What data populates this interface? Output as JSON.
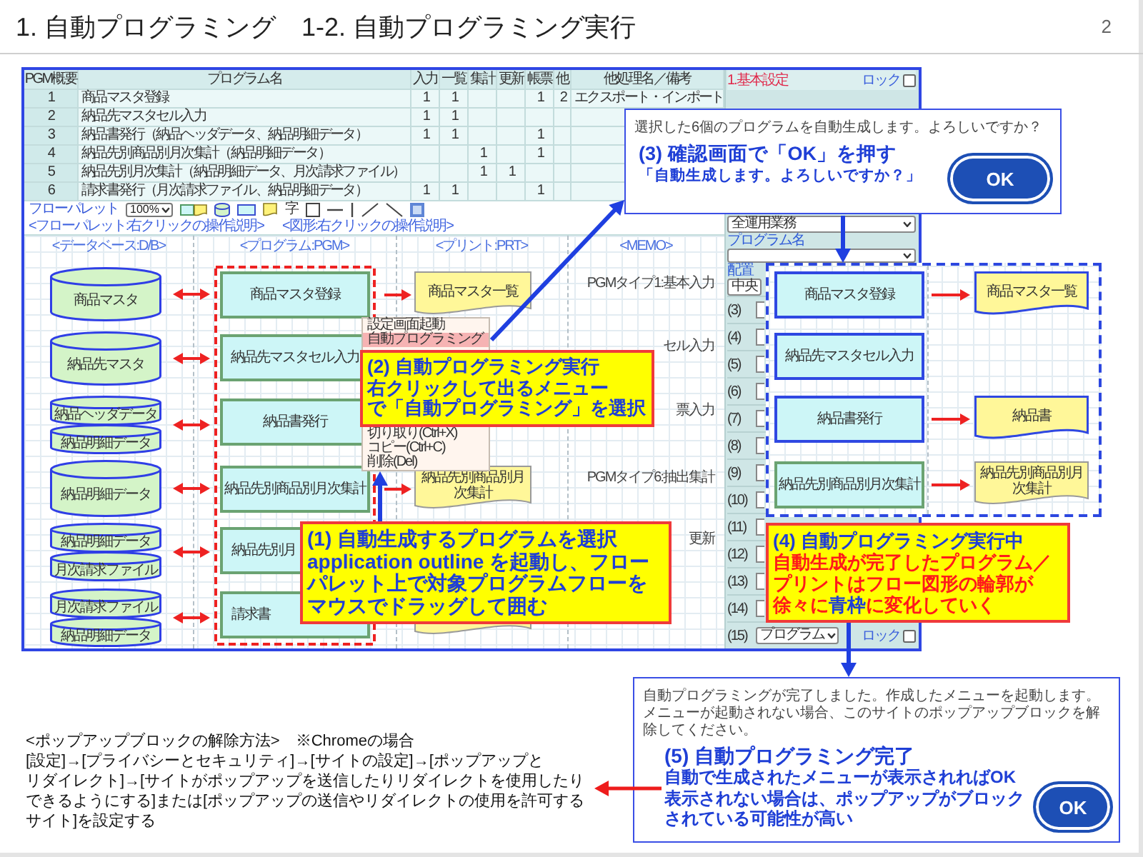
{
  "title": "1. 自動プログラミング　1-2. 自動プログラミング実行",
  "page_number": "2",
  "app": {
    "table": {
      "columns": [
        "PGM概要",
        "プログラム名",
        "入力",
        "一覧",
        "集計",
        "更新",
        "帳票",
        "他",
        "他処理名／備考"
      ],
      "rows": [
        [
          "1",
          "商品マスタ登録",
          "1",
          "1",
          null,
          null,
          "1",
          "2",
          "エクスポート・インポート"
        ],
        [
          "2",
          "納品先マスタセル入力",
          "1",
          "1",
          null,
          null,
          null,
          null,
          null
        ],
        [
          "3",
          "納品書発行（納品ヘッダデータ、納品明細データ）",
          "1",
          "1",
          null,
          null,
          "1",
          null,
          null
        ],
        [
          "4",
          "納品先別商品別月次集計（納品明細データ）",
          null,
          null,
          "1",
          null,
          "1",
          null,
          null
        ],
        [
          "5",
          "納品先別月次集計（納品明細データ、月次請求ファイル）",
          null,
          null,
          "1",
          "1",
          null,
          null,
          null
        ],
        [
          "6",
          "請求書発行（月次請求ファイル、納品明細データ）",
          "1",
          "1",
          null,
          null,
          "1",
          null,
          null
        ]
      ]
    },
    "toolbar": {
      "label": "フローパレット",
      "zoom": "100%",
      "tools": [
        {
          "kind": "process-document"
        },
        {
          "kind": "cylinder"
        },
        {
          "kind": "rectangle"
        },
        {
          "kind": "document"
        },
        {
          "kind": "text",
          "label": "字"
        },
        {
          "kind": "square"
        },
        {
          "kind": "horizontal-line"
        },
        {
          "kind": "vertical-line"
        },
        {
          "kind": "rising-line"
        },
        {
          "kind": "falling-line"
        },
        {
          "kind": "image"
        }
      ],
      "links": [
        "<フローパレット:右クリックの操作説明>",
        "<図形:右クリックの操作説明>"
      ]
    },
    "flow": {
      "lanes": [
        "<データベース:D/B>",
        "<プログラム:PGM>",
        "<プリント:PRT>",
        "<MEMO>"
      ],
      "rows": [
        {
          "databases": [
            "商品マスタ"
          ],
          "program": {
            "label": "商品マスタ登録",
            "clipped": false
          },
          "link": true,
          "print": {
            "kind": "document",
            "label": "商品マスタ一覧"
          },
          "memo": "PGMタイプ1:基本入力"
        },
        {
          "databases": [
            "納品先マスタ"
          ],
          "program": {
            "label": "納品先マスタセル入力",
            "clipped": false
          },
          "memo": "セル入力"
        },
        {
          "databases": [
            "納品ヘッダデータ",
            "納品明細データ"
          ],
          "program": {
            "label": "納品書発行",
            "clipped": false
          },
          "memo": "票入力"
        },
        {
          "databases": [
            "納品明細データ"
          ],
          "program": {
            "label": "納品先別商品別月次集計",
            "clipped": false
          },
          "link": true,
          "print": {
            "kind": "document",
            "label": "納品先別商品別月次集計"
          },
          "memo": "PGMタイプ6:抽出集計"
        },
        {
          "databases": [
            "納品明細データ",
            "月次請求ファイル"
          ],
          "program": {
            "label": "納品先別月",
            "clipped": true
          },
          "memo": "更新"
        },
        {
          "databases": [
            "月次請求ファイル",
            "納品明細データ"
          ],
          "program": {
            "label": "請求書",
            "clipped": true
          },
          "print": {
            "kind": "document-edge"
          }
        }
      ]
    },
    "panel": {
      "title": "1.基本設定",
      "lock_label": "ロック",
      "locked": false,
      "business": "全運用業務",
      "program_label": "プログラム名",
      "align_label": "配置",
      "align": "中央",
      "slots": [
        {
          "label": "(3)"
        },
        {
          "label": "(4)"
        },
        {
          "label": "(5)"
        },
        {
          "label": "(6)"
        },
        {
          "label": "(7)"
        },
        {
          "label": "(8)"
        },
        {
          "label": "(9)"
        },
        {
          "label": "(10)"
        },
        {
          "label": "(11)"
        },
        {
          "label": "(12)"
        },
        {
          "label": "(13)"
        },
        {
          "label": "(14)"
        },
        {
          "label": "(15)",
          "value": "プログラム",
          "lock_label": "ロック",
          "locked": false
        }
      ]
    }
  },
  "context_menu": {
    "items": [
      {
        "label": "設定画面起動",
        "selected": false
      },
      {
        "label": "自動プログラミング",
        "selected": true
      }
    ],
    "lower_items": [
      {
        "label": "切り取り(Ctrl+X)",
        "selected": false
      },
      {
        "label": "コピー(Ctrl+C)",
        "selected": false
      },
      {
        "label": "削除(Del)",
        "selected": false
      }
    ]
  },
  "preview": {
    "rows": [
      {
        "program": {
          "label": "商品マスタ登録",
          "done": true
        },
        "print": {
          "label": "商品マスタ一覧",
          "done": true
        }
      },
      {
        "program": {
          "label": "納品先マスタセル入力",
          "done": true
        }
      },
      {
        "program": {
          "label": "納品書発行",
          "done": true
        },
        "print": {
          "label": "納品書",
          "done": true
        }
      },
      {
        "program": {
          "label": "納品先別商品別月次集計",
          "done": false
        },
        "print": {
          "label": "納品先別商品別月次集計",
          "done": false
        }
      }
    ]
  },
  "steps": [
    {
      "kind": "dialog",
      "messages": [
        "選択した6個のプログラムを自動生成します。よろしいですか？"
      ],
      "note_heading": "(3) 確認画面で「OK」を押す",
      "note_lines": [
        "「自動生成します。よろしいですか？」"
      ],
      "button": "OK"
    },
    {
      "kind": "callout",
      "lines": [
        [
          {
            "text": "(2) 自動プログラミング実行",
            "color": "#1f3fd6"
          }
        ],
        [
          {
            "text": "右クリックして出るメニュー",
            "color": "#1f3fd6"
          }
        ],
        [
          {
            "text": "で「自動プログラミング」を選択",
            "color": "#1f3fd6"
          }
        ]
      ]
    },
    {
      "kind": "callout",
      "lines": [
        [
          {
            "text": "(1) 自動生成するプログラムを選択",
            "color": "#1f3fd6"
          }
        ],
        [
          {
            "text": "application outline を起動し、フロー",
            "color": "#1f3fd6"
          }
        ],
        [
          {
            "text": "パレット上で対象プログラムフローを",
            "color": "#1f3fd6"
          }
        ],
        [
          {
            "text": "マウスでドラッグして囲む",
            "color": "#1f3fd6"
          }
        ]
      ]
    },
    {
      "kind": "callout",
      "lines": [
        [
          {
            "text": "(4) 自動プログラミング実行中",
            "color": "#1f3fd6"
          }
        ],
        [
          {
            "text": "自動生成が完了したプログラム／",
            "color": "#ff1a1a"
          }
        ],
        [
          {
            "text": "プリントはフロー図形の輪郭が",
            "color": "#ff1a1a"
          }
        ],
        [
          {
            "text": "徐々に",
            "color": "#ff1a1a"
          },
          {
            "text": "青枠",
            "color": "#1f3fd6"
          },
          {
            "text": "に変化していく",
            "color": "#ff1a1a"
          }
        ]
      ]
    },
    {
      "kind": "dialog",
      "messages": [
        "自動プログラミングが完了しました。作成したメニューを起動します。",
        "メニューが起動されない場合、このサイトのポップアップブロックを解除してください。"
      ],
      "note_heading": "(5) 自動プログラミング完了",
      "note_lines": [
        "自動で生成されたメニューが表示されればOK",
        "表示されない場合は、ポップアップがブロック",
        "されている可能性が高い"
      ],
      "button": "OK"
    }
  ],
  "help": {
    "heading": "<ポップアップブロックの解除方法>　※Chromeの場合",
    "lines": [
      "[設定]→[プライバシーとセキュリティ]→[サイトの設定]→[ポップアップと",
      "リダイレクト]→[サイトがポップアップを送信したりリダイレクトを使用したり",
      "できるようにする]または[ポップアップの送信やリダイレクトの使用を許可する",
      "サイト]を設定する"
    ]
  }
}
